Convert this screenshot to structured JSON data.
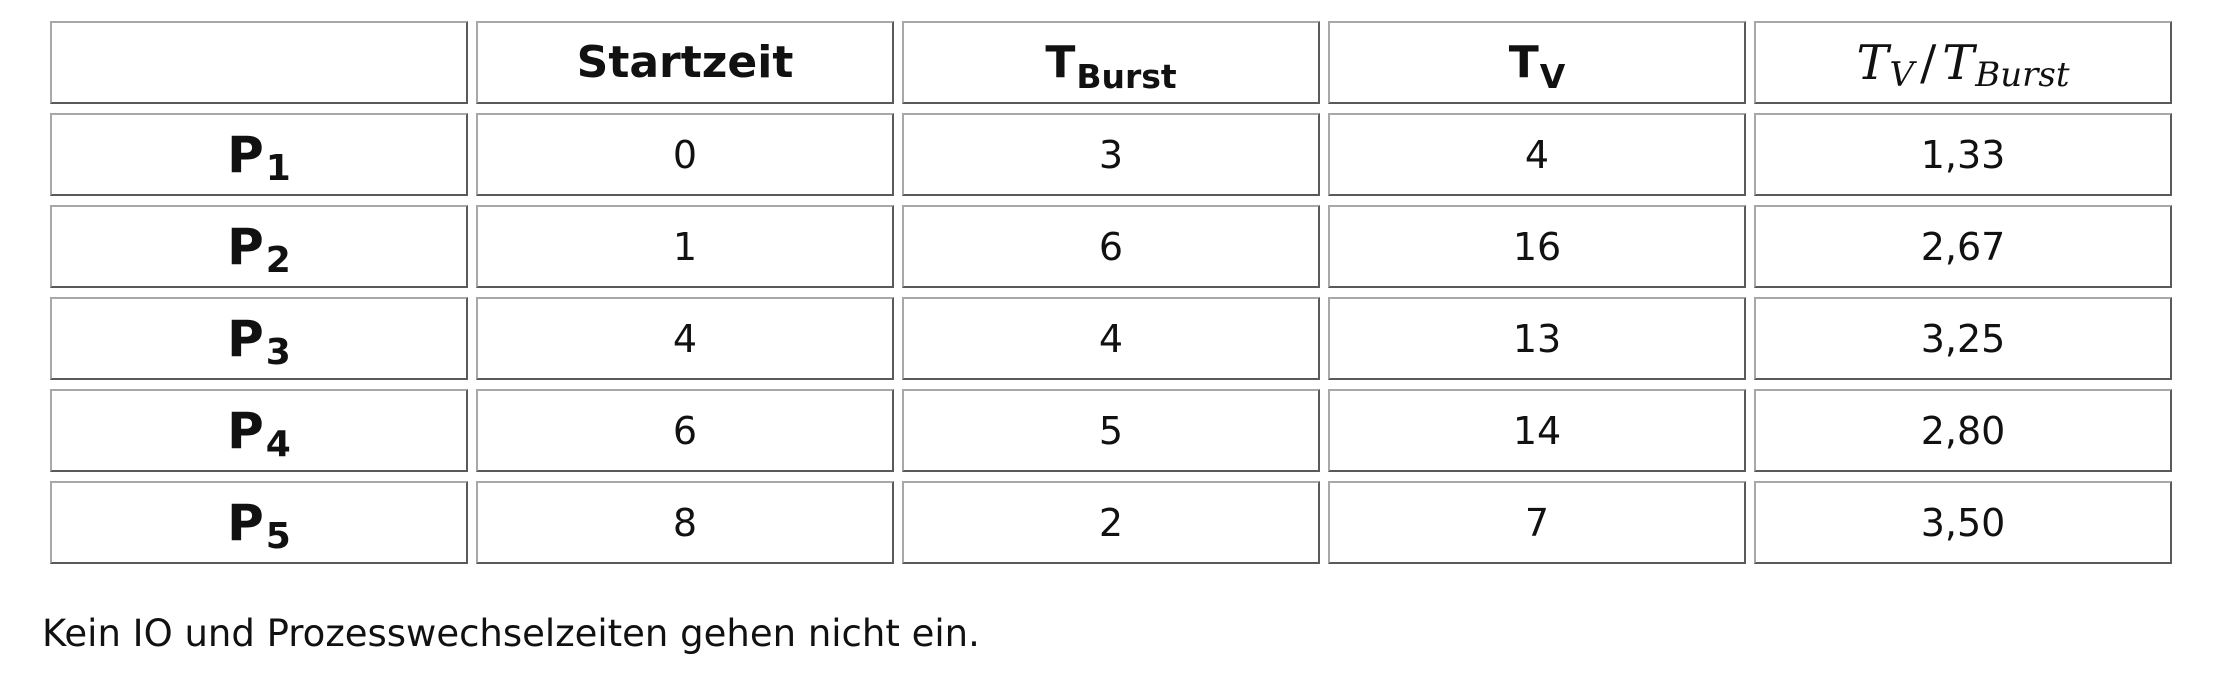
{
  "table": {
    "headers": [
      {
        "main": "",
        "sub": ""
      },
      {
        "main": "Startzeit",
        "sub": ""
      },
      {
        "main": "T",
        "sub": "Burst"
      },
      {
        "main": "T",
        "sub": "V"
      },
      {
        "formula": true,
        "a": "T",
        "a_sub": "V",
        "slash": "/",
        "b": "T",
        "b_sub": "Burst"
      }
    ],
    "rows": [
      {
        "label": "P",
        "label_sub": "1",
        "startzeit": "0",
        "t_burst": "3",
        "t_v": "4",
        "ratio": "1,33"
      },
      {
        "label": "P",
        "label_sub": "2",
        "startzeit": "1",
        "t_burst": "6",
        "t_v": "16",
        "ratio": "2,67"
      },
      {
        "label": "P",
        "label_sub": "3",
        "startzeit": "4",
        "t_burst": "4",
        "t_v": "13",
        "ratio": "3,25"
      },
      {
        "label": "P",
        "label_sub": "4",
        "startzeit": "6",
        "t_burst": "5",
        "t_v": "14",
        "ratio": "2,80"
      },
      {
        "label": "P",
        "label_sub": "5",
        "startzeit": "8",
        "t_burst": "2",
        "t_v": "7",
        "ratio": "3,50"
      }
    ]
  },
  "note": "Kein IO und Prozesswechselzeiten gehen nicht ein."
}
